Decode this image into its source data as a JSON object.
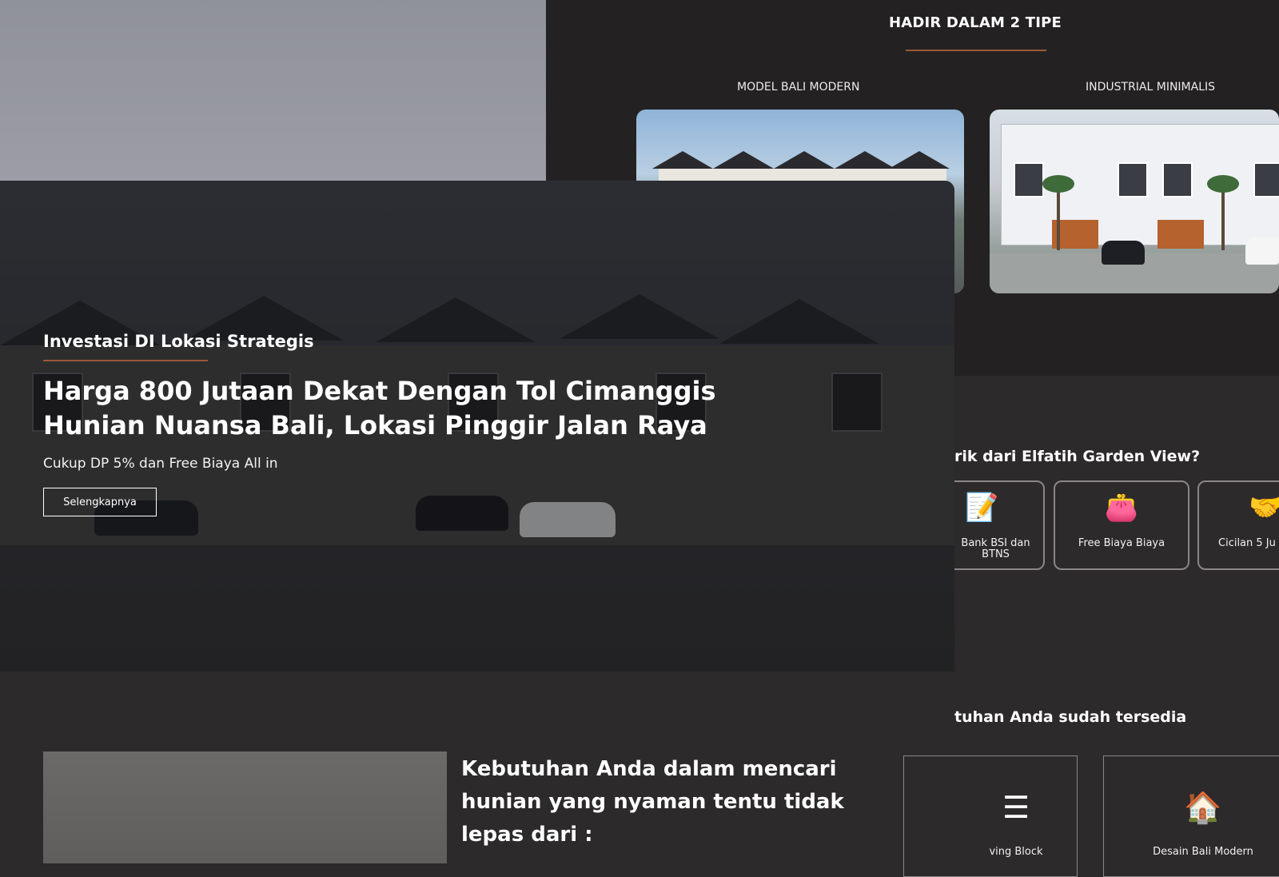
{
  "types": {
    "title": "HADIR DALAM 2 TIPE",
    "items": [
      {
        "label": "MODEL BALI MODERN"
      },
      {
        "label": "INDUSTRIAL MINIMALIS"
      }
    ]
  },
  "why": {
    "title": "rik dari Elfatih Garden View?",
    "features": [
      {
        "icon": "contract-icon",
        "label": "Bank BSI dan BTNS"
      },
      {
        "icon": "wallet-money-icon",
        "label": "Free Biaya Biaya"
      },
      {
        "icon": "handshake-money-icon",
        "label": "Cicilan 5 Ju"
      }
    ]
  },
  "needs": {
    "title": "tuhan Anda sudah tersedia",
    "items": [
      {
        "icon": "layers-icon",
        "label": "ving Block"
      },
      {
        "icon": "house-icon",
        "label": "Desain Bali Modern"
      }
    ]
  },
  "hero": {
    "eyebrow": "Investasi DI Lokasi Strategis",
    "title_line1": "Harga 800 Jutaan Dekat Dengan Tol Cimanggis",
    "title_line2": "Hunian Nuansa Bali, Lokasi Pinggir Jalan Raya",
    "subtitle": "Cukup DP 5% dan Free Biaya All in",
    "button_label": "Selengkapnya"
  },
  "intro": {
    "line1": "Kebutuhan Anda dalam mencari",
    "line2": "hunian yang nyaman tentu tidak",
    "line3": "lepas dari :"
  },
  "colors": {
    "accent": "#9a5a36",
    "panel_dark": "#232122",
    "page_bg": "#2c2a2b"
  }
}
